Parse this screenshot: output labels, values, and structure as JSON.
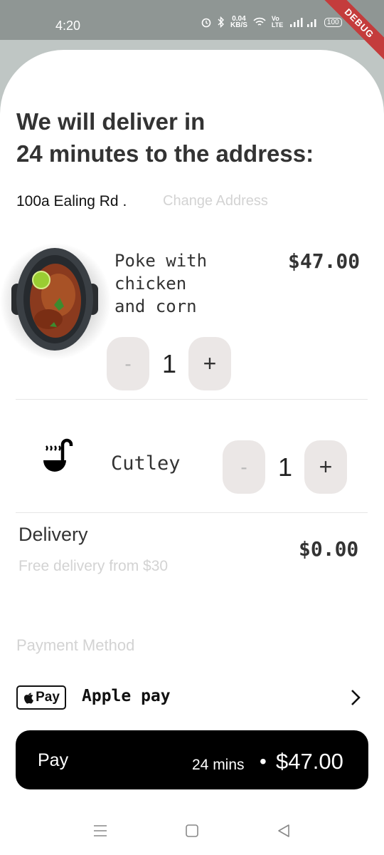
{
  "status_bar": {
    "time": "4:20",
    "net_speed_value": "0.04",
    "net_speed_unit": "KB/S",
    "volte": "Vo LTE",
    "battery": "100",
    "debug_banner": "DEBUG"
  },
  "heading": {
    "line1": "We will deliver in",
    "line2": "24 minutes to the address:"
  },
  "address": {
    "text": "100a Ealing Rd .",
    "change_label": "Change Address"
  },
  "item": {
    "name": "Poke with\nchicken\nand corn",
    "price": "$47.00",
    "minus": "-",
    "quantity": "1",
    "plus": "+"
  },
  "cutlery": {
    "label": "Cutley",
    "minus": "-",
    "quantity": "1",
    "plus": "+"
  },
  "delivery": {
    "title": "Delivery",
    "subtitle": "Free delivery from $30",
    "price": "$0.00"
  },
  "payment": {
    "section_label": "Payment Method",
    "badge": "Pay",
    "method_name": "Apple pay"
  },
  "pay_button": {
    "label": "Pay",
    "time": "24 mins",
    "separator": "•",
    "total": "$47.00"
  },
  "colors": {
    "accent": "#000000",
    "muted_text": "#d3d3d3",
    "stepper_bg": "#ebe7e6",
    "debug_ribbon": "#c43c3c"
  },
  "icons": {
    "status": [
      "alarm-icon",
      "bluetooth-icon",
      "wifi-icon",
      "signal-icon",
      "battery-icon"
    ],
    "cutlery": "ladle-icon",
    "navigation": [
      "menu-icon",
      "home-icon",
      "back-icon"
    ]
  }
}
